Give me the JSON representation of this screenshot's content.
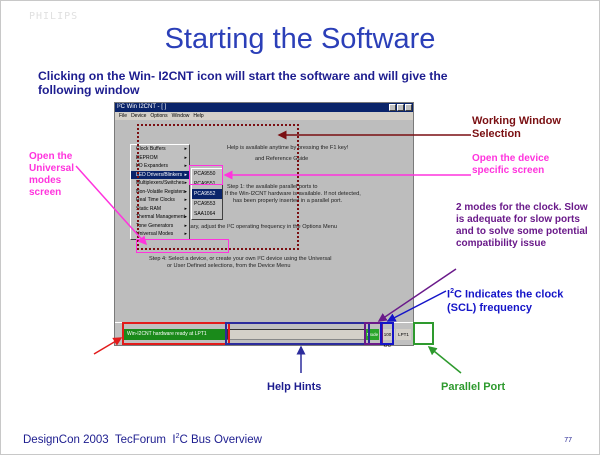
{
  "slide": {
    "watermark": "PHILIPS",
    "title": "Starting the Software",
    "subtitle": "Clicking on the Win- I2CNT icon will start the software and will give the following window",
    "footer": {
      "conference": "DesignCon 2003",
      "forum": "TecForum",
      "topic_pre": "I",
      "topic_sup": "2",
      "topic_post": "C Bus Overview",
      "page": "77"
    }
  },
  "window": {
    "title": "I²C Win I2CNT - [ ]",
    "menus": [
      "File",
      "Device",
      "Options",
      "Window",
      "Help"
    ],
    "device_menu": [
      "Clock Buffers",
      "EEPROM",
      "I/O Expanders",
      "LED Drivers/Blinkers",
      "Multiplexers/Switches",
      "Non-Volatile Registers",
      "Real Time Clocks",
      "Static RAM",
      "Thermal Management",
      "Tone Generators",
      "Universal Modes"
    ],
    "device_menu_selected": "LED Drivers/Blinkers",
    "led_submenu": [
      "PCA9550",
      "PCA9551",
      "PCA9552",
      "PCA9553",
      "SAA1064"
    ],
    "led_submenu_selected": "PCA9552",
    "body_lines": {
      "help": "Help is available anytime by pressing the F1 key!",
      "ref": "and Reference Guide",
      "detect1": "Step 1: the available parallel ports to",
      "detect2": "If the Win-I2CNT hardware is available. If not detected,",
      "detect3": "has been properly inserted in a parallel port.",
      "step2": "Step 2: If necessary, adjust the I²C operating frequency in the Options Menu",
      "step4a": "Step 4: Select a device, or create your own I²C device using the Universal",
      "step4b": "or User Defined selections, from the Device Menu"
    },
    "status": {
      "ready": "Win-I2CNT hardware ready at LPT1",
      "mode": "Mode",
      "freq": "100 kHz",
      "port": "LPT1"
    }
  },
  "annotations": {
    "working_window": "Working Window Selection",
    "open_device": "Open the device specific screen",
    "open_universal": "Open the Universal modes screen",
    "clock_modes": "2 modes for the clock. Slow is adequate for slow ports and to solve some potential compatibility issue",
    "i2c_pre": "I",
    "i2c_sup": "2",
    "i2c_post": "C Indicates the clock  (SCL) frequency",
    "help_hints": "Help Hints",
    "parallel_port": "Parallel Port"
  },
  "colors": {
    "title": "#2b3fb8",
    "subtitle": "#1d1d8f",
    "maroon": "#7a0f12",
    "magenta": "#ff33dd",
    "purple": "#6a1a8a",
    "blue": "#1414c8",
    "green": "#2e9a2e",
    "red": "#e21b1b"
  }
}
